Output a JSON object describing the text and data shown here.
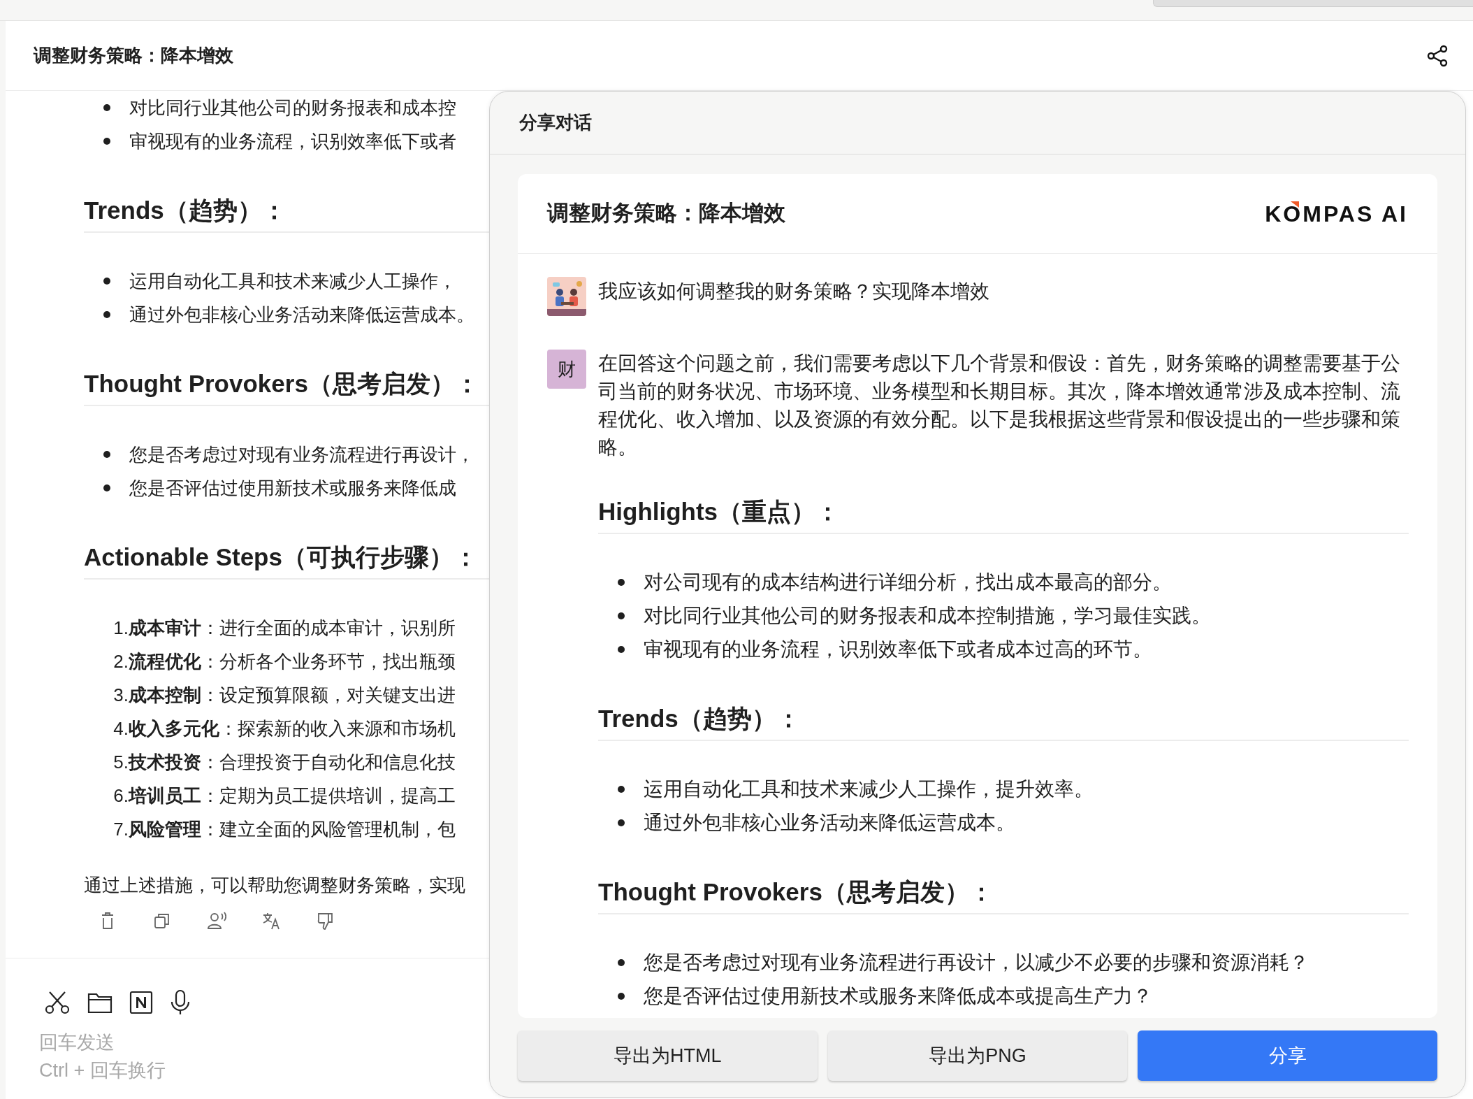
{
  "header": {
    "title": "调整财务策略：降本增效"
  },
  "conversation": {
    "blocks": [
      {
        "kind": "bullets",
        "items": [
          "对比同行业其他公司的财务报表和成本控",
          "审视现有的业务流程，识别效率低下或者"
        ]
      },
      {
        "kind": "heading",
        "text": "Trends（趋势）："
      },
      {
        "kind": "bullets",
        "items": [
          "运用自动化工具和技术来减少人工操作，",
          "通过外包非核心业务活动来降低运营成本。"
        ]
      },
      {
        "kind": "heading",
        "text": "Thought Provokers（思考启发）："
      },
      {
        "kind": "bullets",
        "items": [
          "您是否考虑过对现有业务流程进行再设计，",
          "您是否评估过使用新技术或服务来降低成"
        ]
      },
      {
        "kind": "heading",
        "text": "Actionable Steps（可执行步骤）："
      },
      {
        "kind": "steps",
        "items": [
          {
            "number": "1.",
            "text": "**成本审计**：进行全面的成本审计，识别所"
          },
          {
            "number": "2.",
            "text": "**流程优化**：分析各个业务环节，找出瓶颈"
          },
          {
            "number": "3.",
            "text": "**成本控制**：设定预算限额，对关键支出进"
          },
          {
            "number": "4.",
            "text": "**收入多元化**：探索新的收入来源和市场机"
          },
          {
            "number": "5.",
            "text": "**技术投资**：合理投资于自动化和信息化技"
          },
          {
            "number": "6.",
            "text": "**培训员工**：定期为员工提供培训，提高工"
          },
          {
            "number": "7.",
            "text": "**风险管理**：建立全面的风险管理机制，包"
          }
        ]
      },
      {
        "kind": "paragraph",
        "text": "通过上述措施，可以帮助您调整财务策略，实现"
      }
    ]
  },
  "composer": {
    "placeholder": "回车发送\nCtrl + 回车换行"
  },
  "share_dialog": {
    "title": "分享对话",
    "card": {
      "title": "调整财务策略：降本增效",
      "brand": "KOMPAS AI",
      "messages": [
        {
          "kind": "user",
          "text": "我应该如何调整我的财务策略？实现降本增效"
        },
        {
          "kind": "assistant",
          "avatar_text": "财",
          "text": "在回答这个问题之前，我们需要考虑以下几个背景和假设：首先，财务策略的调整需要基于公司当前的财务状况、市场环境、业务模型和长期目标。其次，降本增效通常涉及成本控制、流程优化、收入增加、以及资源的有效分配。以下是我根据这些背景和假设提出的一些步骤和策略。",
          "blocks": [
            {
              "kind": "heading",
              "text": "Highlights（重点）："
            },
            {
              "kind": "bullets",
              "items": [
                "对公司现有的成本结构进行详细分析，找出成本最高的部分。",
                "对比同行业其他公司的财务报表和成本控制措施，学习最佳实践。",
                "审视现有的业务流程，识别效率低下或者成本过高的环节。"
              ]
            },
            {
              "kind": "heading",
              "text": "Trends（趋势）："
            },
            {
              "kind": "bullets",
              "items": [
                "运用自动化工具和技术来减少人工操作，提升效率。",
                "通过外包非核心业务活动来降低运营成本。"
              ]
            },
            {
              "kind": "heading",
              "text": "Thought Provokers（思考启发）："
            },
            {
              "kind": "bullets",
              "items": [
                "您是否考虑过对现有业务流程进行再设计，以减少不必要的步骤和资源消耗？",
                "您是否评估过使用新技术或服务来降低成本或提高生产力？"
              ]
            }
          ]
        }
      ]
    },
    "buttons": [
      {
        "label": "导出为HTML",
        "kind": "secondary"
      },
      {
        "label": "导出为PNG",
        "kind": "secondary"
      },
      {
        "label": "分享",
        "kind": "primary"
      }
    ]
  }
}
